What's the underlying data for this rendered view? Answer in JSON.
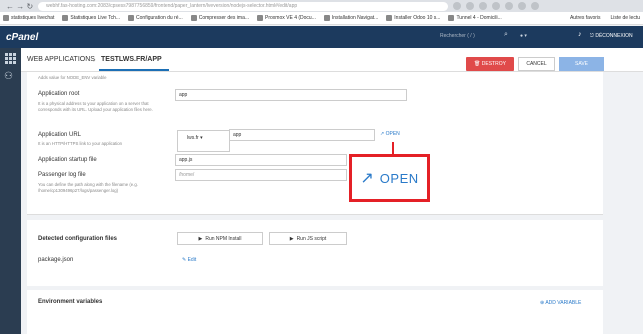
{
  "browser": {
    "nav_glyph": "← → ↻",
    "url": "webhf.fas-hosting.com:2083/cpsess7987756859/frontend/paper_lantern/lveversion/nodejs-selector.html#/edit/app",
    "bookmarks": [
      "statistiques livechat",
      "Statistiques Live Tch...",
      "Configuration du ré...",
      "Compresser des ima...",
      "Proxmox VE 4 (Docu...",
      "Installation Navigat...",
      "Installer Odoo 10 s...",
      "Tunnel 4 - Domicili..."
    ],
    "bookmarks_right": [
      "Autres favoris",
      "Liste de lectu"
    ]
  },
  "cpanel": {
    "logo": "cPanel",
    "search_placeholder": "Rechercher ( / )",
    "user": "",
    "logout": "DÉCONNEXION"
  },
  "topbar": {
    "crumb_parent": "WEB APPLICATIONS",
    "crumb_separator": "›",
    "crumb_current": "TESTLWS.FR/APP",
    "destroy_label": "DESTROY",
    "cancel_label": "CANCEL",
    "save_label": "SAVE"
  },
  "form": {
    "top_hint": "Adds value for NODE_ENV variable",
    "app_root": {
      "label": "Application root",
      "hint": "It is a physical address to your application on a server that corresponds with its URL. Upload your application files here.",
      "value": "app"
    },
    "app_url": {
      "label": "Application URL",
      "hint": "It is an HTTP/HTTPS link to your application",
      "domain": "lws.fr",
      "dropdown_glyph": "▾",
      "value": "app",
      "open_label": "OPEN"
    },
    "startup_file": {
      "label": "Application startup file",
      "value": "app.js"
    },
    "log_file": {
      "label": "Passenger log file",
      "hint": "You can define the path along with the filename (e.g. /home/cp1309496p27/logs/passenger.log)",
      "value": "/home/"
    }
  },
  "callout": {
    "label": "OPEN"
  },
  "config_files": {
    "title": "Detected configuration files",
    "run_npm_label": "Run NPM Install",
    "run_js_label": "Run JS script",
    "play_glyph": "▶",
    "file_name": "package.json",
    "edit_label": "Edit"
  },
  "env": {
    "title": "Environment variables",
    "add_label": "ADD VARIABLE"
  },
  "colors": {
    "header_bg": "#1c3a5e",
    "sidebar_bg": "#2b3d51",
    "destroy": "#e04a4a",
    "save": "#8cb4e6",
    "link": "#2a7ac9",
    "callout_border": "#e42026"
  },
  "icons": {
    "external_link": "external-link-icon",
    "edit": "pencil-icon",
    "add": "plus-circle-icon",
    "bell": "bell-icon",
    "grid": "apps-grid-icon",
    "users": "users-icon",
    "search": "search-icon"
  }
}
